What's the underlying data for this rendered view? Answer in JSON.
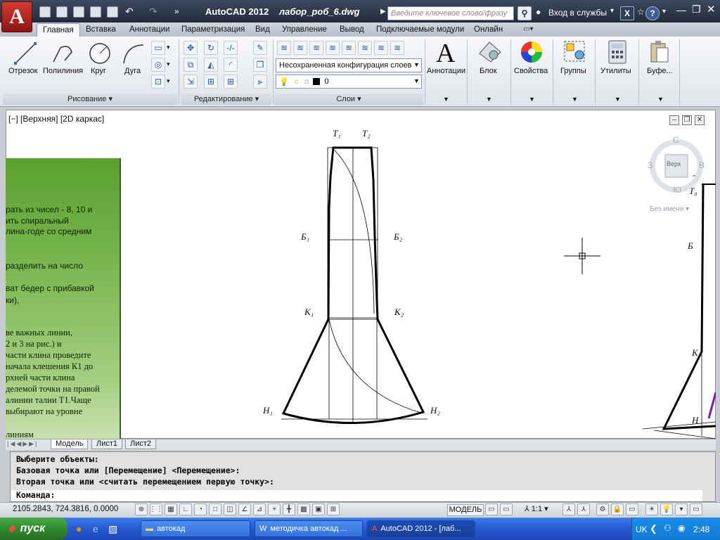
{
  "app": {
    "title": "AutoCAD 2012",
    "filename": "лабор_роб_6.dwg",
    "search_placeholder": "Введите ключевое слово/фразу",
    "login": "Вход в службы",
    "brand_color": "#c22a22"
  },
  "tabs": [
    "Главная",
    "Вставка",
    "Аннотации",
    "Параметризация",
    "Вид",
    "Управление",
    "Вывод",
    "Подключаемые модули",
    "Онлайн"
  ],
  "ribbon": {
    "draw": {
      "line": "Отрезок",
      "polyline": "Полилиния",
      "circle": "Круг",
      "arc": "Дуга",
      "title": "Рисование"
    },
    "modify": {
      "title": "Редактирование"
    },
    "layers": {
      "state": "Несохраненная конфигурация слоев",
      "current": "0",
      "title": "Слои"
    },
    "annotations": "Аннотации",
    "block": "Блок",
    "properties": "Свойства",
    "groups": "Группы",
    "utilities": "Утилиты",
    "clipboard": "Буфе..."
  },
  "viewport": {
    "label": "[−] [Верхняя] [2D каркас]",
    "cube_top": "Верх",
    "cube_n": "С",
    "cube_s": "Ю",
    "cube_w": "З",
    "cube_e": "В",
    "ucs": "Без имени"
  },
  "drawing": {
    "t1": "Т₁",
    "t2": "Т₂",
    "b1": "Б₁",
    "b2": "Б₂",
    "k1": "К₁",
    "k2": "К₂",
    "n1": "Н₁",
    "n2": "Н₂",
    "rt": "Т",
    "rt0": "Т₀",
    "rb": "Б",
    "rk": "К",
    "rn": "Н"
  },
  "doc_text": [
    "рать из чисел - 8, 10 и",
    "ить спиральный",
    "лина-годе со средним",
    "разделить на число",
    "ват бедер с прибавкой",
    "ки),",
    "ве важных линии,",
    "2 и 3 на рис.) и",
    "части клина проведите",
    "начала клешения К1 до",
    "рхней части клина",
    "делемой точки на правой",
    "алинии талии Т1.Чаще",
    "выбирают на уровне",
    "линиям"
  ],
  "layout_tabs": [
    "Модель",
    "Лист1",
    "Лист2"
  ],
  "command": {
    "lines": [
      "Выберите объекты:",
      "Базовая точка или [Перемещение] <Перемещение>:",
      "Вторая точка или <считать перемещением первую точку>:"
    ],
    "prompt": "Команда:"
  },
  "status": {
    "coords": "2105.2843, 724.3816, 0.0000",
    "model": "МОДЕЛЬ",
    "scale": "1:1"
  },
  "taskbar": {
    "start": "пуск",
    "items": [
      "автокад",
      "методичка автокад ...",
      "AutoCAD 2012 - [лаб..."
    ],
    "lang": "UK",
    "time": "2:48"
  }
}
